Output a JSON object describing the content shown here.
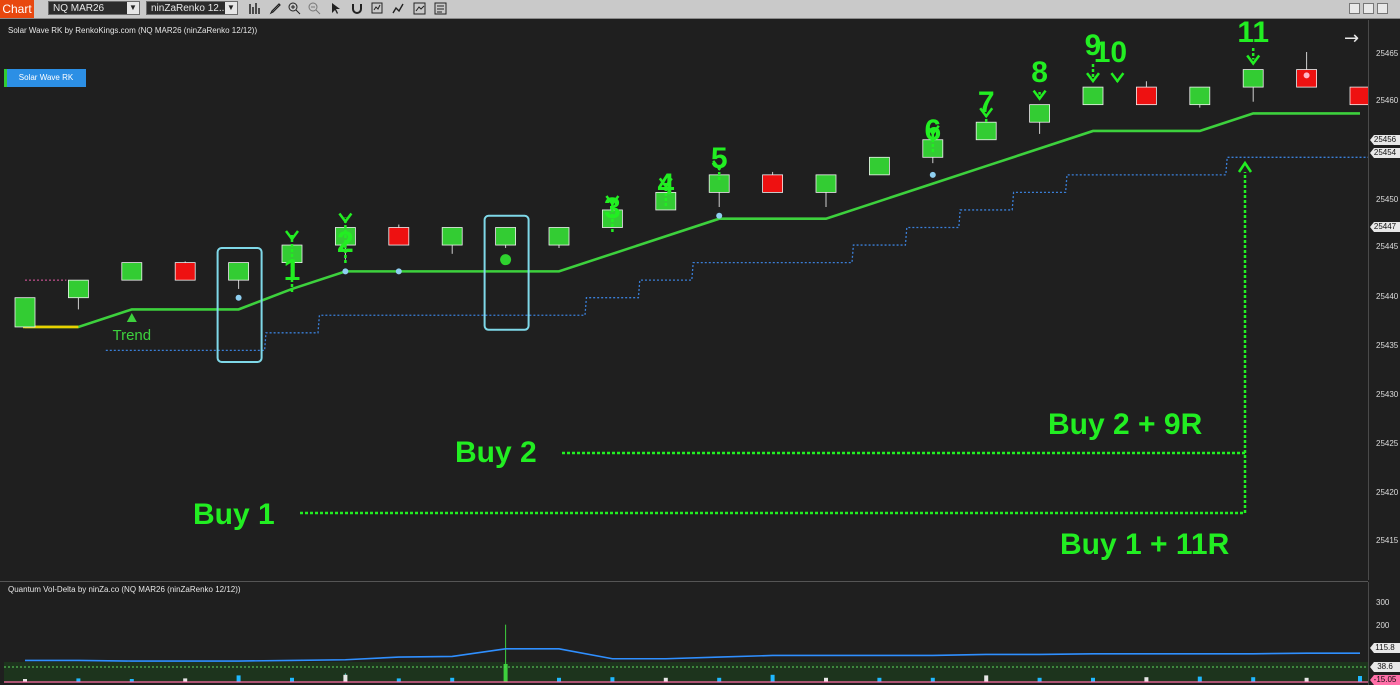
{
  "toolbar": {
    "tab_label": "Chart",
    "instrument": "NQ MAR26",
    "bar_type": "ninZaRenko 12...",
    "icons": [
      "bar-chart-icon",
      "pencil-icon",
      "zoom-in-icon",
      "zoom-out-icon",
      "pointer-icon",
      "magnet-icon",
      "strategy-icon",
      "indicator-icon",
      "chart-style-icon",
      "properties-icon"
    ],
    "window_buttons": [
      "minimize",
      "maximize",
      "close"
    ]
  },
  "main_pane": {
    "title": "Solar Wave RK by RenkoKings.com (NQ MAR26 (ninZaRenko 12/12))",
    "indicator_button": "Solar Wave RK",
    "trend_label": "Trend",
    "arrow_glyph": "→"
  },
  "sub_pane": {
    "title": "Quantum Vol-Delta by ninZa.co (NQ MAR26 (ninZaRenko 12/12))"
  },
  "price_axis": {
    "ticks": [
      "25465",
      "25460",
      "25456",
      "25454",
      "25450",
      "25447",
      "25445",
      "25440",
      "25435",
      "25430",
      "25425",
      "25420",
      "25415"
    ],
    "tags": [
      {
        "label": "25456",
        "color": "#e8e8e8"
      },
      {
        "label": "25454",
        "color": "#e8e8e8"
      },
      {
        "label": "25447",
        "color": "#e8e8e8"
      }
    ]
  },
  "sub_axis": {
    "ticks": [
      "300",
      "200",
      "100"
    ],
    "tags": [
      {
        "label": "115.8",
        "color": "#e8e8e8"
      },
      {
        "label": "38.6",
        "color": "#e8e8e8"
      },
      {
        "label": "-15.05",
        "color": "#ff6fa8"
      }
    ]
  },
  "annotations": {
    "numbers": [
      "1",
      "2",
      "3",
      "4",
      "5",
      "6",
      "7",
      "8",
      "9",
      "10",
      "11"
    ],
    "buy1": "Buy 1",
    "buy2": "Buy 2",
    "result2": "Buy 2 + 9R",
    "result1": "Buy 1 + 11R"
  },
  "colors": {
    "bull": "#33cc33",
    "bear": "#ee1111",
    "trend_line": "#3dd13d",
    "stop_line": "#3a7fd8",
    "annotation": "#22ee22",
    "box": "#7fd8e8"
  },
  "chart_data": {
    "type": "candlestick",
    "instrument": "NQ MAR26",
    "bar_type": "ninZaRenko 12/12",
    "y_range": [
      25412,
      25467
    ],
    "candles": [
      {
        "open": 25418,
        "close": 25423,
        "high": 25423,
        "low": 25418,
        "dir": "up"
      },
      {
        "open": 25423,
        "close": 25426,
        "high": 25426,
        "low": 25421,
        "dir": "up"
      },
      {
        "open": 25426,
        "close": 25429,
        "high": 25429,
        "low": 25426,
        "dir": "up"
      },
      {
        "open": 25429,
        "close": 25426,
        "high": 25429.2,
        "low": 25426,
        "dir": "down"
      },
      {
        "open": 25426,
        "close": 25429,
        "high": 25429,
        "low": 25424.5,
        "dir": "up"
      },
      {
        "open": 25429,
        "close": 25432,
        "high": 25432,
        "low": 25429,
        "dir": "up"
      },
      {
        "open": 25432,
        "close": 25435,
        "high": 25435,
        "low": 25429.5,
        "dir": "up"
      },
      {
        "open": 25435,
        "close": 25432,
        "high": 25435.5,
        "low": 25432,
        "dir": "down"
      },
      {
        "open": 25432,
        "close": 25435,
        "high": 25435,
        "low": 25430.5,
        "dir": "up"
      },
      {
        "open": 25432,
        "close": 25435,
        "high": 25435,
        "low": 25431.5,
        "dir": "up"
      },
      {
        "open": 25432,
        "close": 25435,
        "high": 25435,
        "low": 25431.5,
        "dir": "up"
      },
      {
        "open": 25435,
        "close": 25438,
        "high": 25438,
        "low": 25435,
        "dir": "up"
      },
      {
        "open": 25438,
        "close": 25441,
        "high": 25441,
        "low": 25438,
        "dir": "up"
      },
      {
        "open": 25441,
        "close": 25444,
        "high": 25444,
        "low": 25438.5,
        "dir": "up"
      },
      {
        "open": 25444,
        "close": 25441,
        "high": 25444.5,
        "low": 25441,
        "dir": "down"
      },
      {
        "open": 25441,
        "close": 25444,
        "high": 25444,
        "low": 25438.5,
        "dir": "up"
      },
      {
        "open": 25444,
        "close": 25447,
        "high": 25447,
        "low": 25444,
        "dir": "up"
      },
      {
        "open": 25447,
        "close": 25450,
        "high": 25450,
        "low": 25446,
        "dir": "up"
      },
      {
        "open": 25450,
        "close": 25453,
        "high": 25453,
        "low": 25450,
        "dir": "up"
      },
      {
        "open": 25453,
        "close": 25456,
        "high": 25456,
        "low": 25451,
        "dir": "up"
      },
      {
        "open": 25456,
        "close": 25459,
        "high": 25459,
        "low": 25456,
        "dir": "up"
      },
      {
        "open": 25459,
        "close": 25456,
        "high": 25460,
        "low": 25456,
        "dir": "down"
      },
      {
        "open": 25456,
        "close": 25459,
        "high": 25459,
        "low": 25455.5,
        "dir": "up"
      },
      {
        "open": 25459,
        "close": 25462,
        "high": 25462,
        "low": 25456.5,
        "dir": "up"
      },
      {
        "open": 25462,
        "close": 25459,
        "high": 25465,
        "low": 25459,
        "dir": "down"
      },
      {
        "open": 25459,
        "close": 25456,
        "high": 25459,
        "low": 25456,
        "dir": "down"
      }
    ],
    "trend_line": [
      25418,
      25418,
      25421,
      25421,
      25421,
      25424.5,
      25427.5,
      25427.5,
      25427.5,
      25427.5,
      25427.5,
      25430.5,
      25433.5,
      25436.5,
      25436.5,
      25436.5,
      25439.5,
      25442.5,
      25445.5,
      25448.5,
      25451.5,
      25451.5,
      25451.5,
      25454.5,
      25454.5,
      25454.5
    ],
    "stop_line": [
      null,
      null,
      25414,
      25414,
      25414,
      25417,
      25420,
      25420,
      25420,
      25420,
      25420,
      25423,
      25426,
      25429,
      25429,
      25429,
      25432,
      25435,
      25438,
      25441,
      25444,
      25444,
      25444,
      25447,
      25447,
      25447
    ],
    "signal_dots": [
      {
        "i": 4,
        "y": 25423
      },
      {
        "i": 6,
        "y": 25427.5
      },
      {
        "i": 7,
        "y": 25427.5
      },
      {
        "i": 13,
        "y": 25437
      },
      {
        "i": 17,
        "y": 25444
      },
      {
        "i": 24,
        "y": 25461
      }
    ],
    "volume_bars": [
      3,
      8,
      4,
      3,
      20,
      3,
      28,
      4,
      4,
      185,
      3,
      6,
      3,
      3,
      20,
      3,
      3,
      3,
      18,
      3,
      3,
      3,
      8,
      3,
      3,
      3
    ],
    "volume_avg_line": [
      120,
      120,
      118,
      118,
      118,
      120,
      122,
      130,
      132,
      155,
      155,
      125,
      125,
      130,
      135,
      135,
      135,
      135,
      138,
      138,
      140,
      140,
      140,
      140,
      142,
      142
    ],
    "delta_bars": [
      10,
      12,
      10,
      12,
      22,
      14,
      24,
      12,
      14,
      60,
      14,
      16,
      14,
      14,
      24,
      14,
      14,
      14,
      22,
      14,
      14,
      16,
      18,
      16,
      14,
      20
    ]
  }
}
